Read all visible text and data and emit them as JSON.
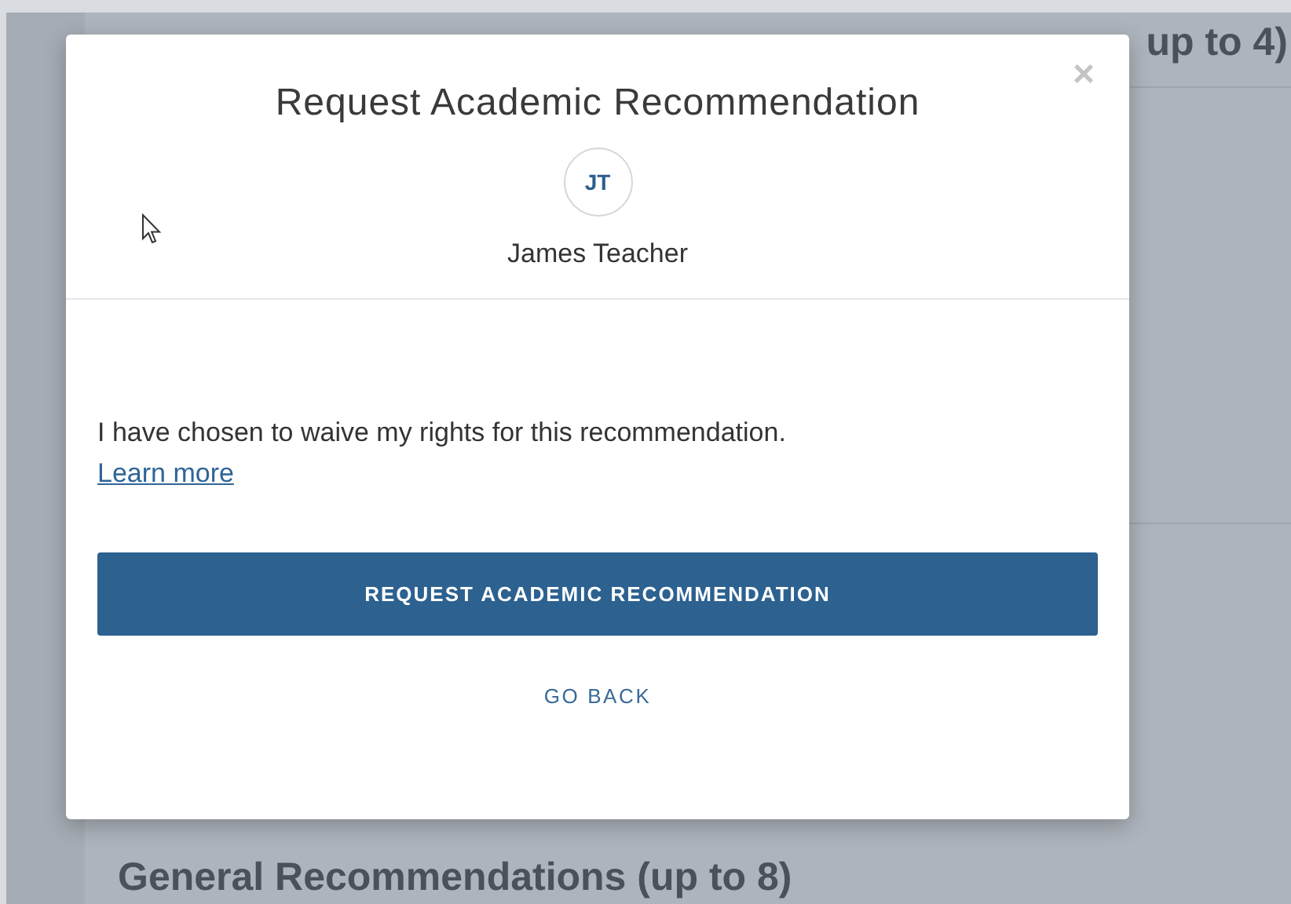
{
  "page": {
    "headings": [
      "up to 4)",
      "General Recommendations (up to 8)"
    ]
  },
  "dialog": {
    "title": "Request Academic Recommendation",
    "close": "×",
    "recommender": {
      "initials": "JT",
      "name": "James Teacher"
    },
    "message": "I have chosen to waive my rights for this recommendation.",
    "link": "Learn more",
    "primary_button": "REQUEST ACADEMIC RECOMMENDATION",
    "secondary_button": "GO BACK"
  }
}
